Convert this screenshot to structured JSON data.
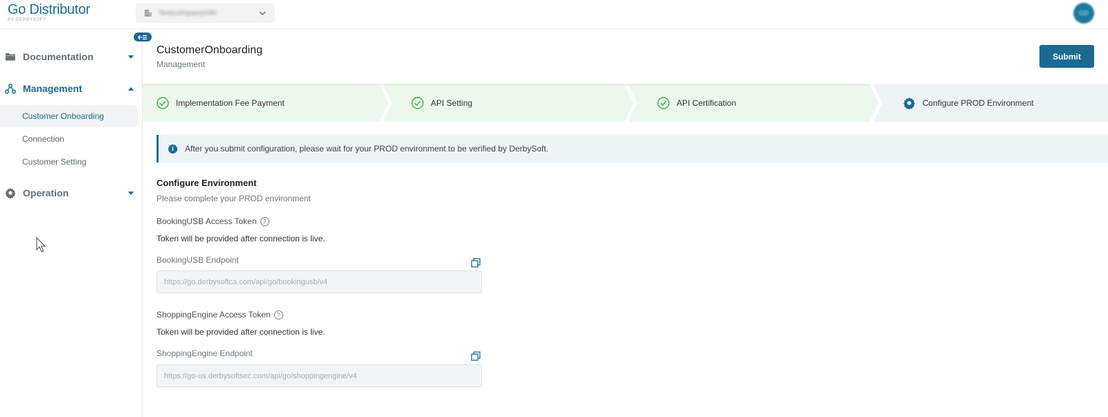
{
  "app": {
    "logo_main": "Go Distributor",
    "logo_sub": "BY DERBYSOFT",
    "company_selector": "Testcompany036",
    "user_initials": "GD"
  },
  "sidebar": {
    "groups": [
      {
        "label": "Documentation",
        "icon": "folder-icon",
        "expanded": false
      },
      {
        "label": "Management",
        "icon": "network-icon",
        "expanded": true,
        "items": [
          {
            "label": "Customer Onboarding",
            "active": true
          },
          {
            "label": "Connection",
            "active": false
          },
          {
            "label": "Customer Setting",
            "active": false
          }
        ]
      },
      {
        "label": "Operation",
        "icon": "gear-icon",
        "expanded": false
      }
    ]
  },
  "header": {
    "title": "CustomerOnboarding",
    "subtitle": "Management",
    "submit_label": "Submit"
  },
  "steps": [
    {
      "label": "Implementation Fee Payment",
      "status": "done"
    },
    {
      "label": "API Setting",
      "status": "done"
    },
    {
      "label": "API Certification",
      "status": "done"
    },
    {
      "label": "Configure PROD Environment",
      "status": "current"
    }
  ],
  "info_message": "After you submit configuration, please wait for your PROD environment to be verified by DerbySoft.",
  "section": {
    "title": "Configure Environment",
    "description": "Please complete your PROD environment"
  },
  "fields": {
    "booking_token_label": "BookingUSB Access Token",
    "booking_token_note": "Token will be provided after connection is live.",
    "booking_endpoint_label": "BookingUSB Endpoint",
    "booking_endpoint_value": "https://go.derbysoftca.com/api/go/bookingusb/v4",
    "shopping_token_label": "ShoppingEngine Access Token",
    "shopping_token_note": "Token will be provided after connection is live.",
    "shopping_endpoint_label": "ShoppingEngine Endpoint",
    "shopping_endpoint_value": "https://go-us.derbysoftsec.com/api/go/shoppingengine/v4"
  },
  "colors": {
    "brand": "#1b6a90",
    "step_done_bg": "#edf8ec",
    "step_current_bg": "#eef3f6",
    "success": "#3eaf4a"
  }
}
